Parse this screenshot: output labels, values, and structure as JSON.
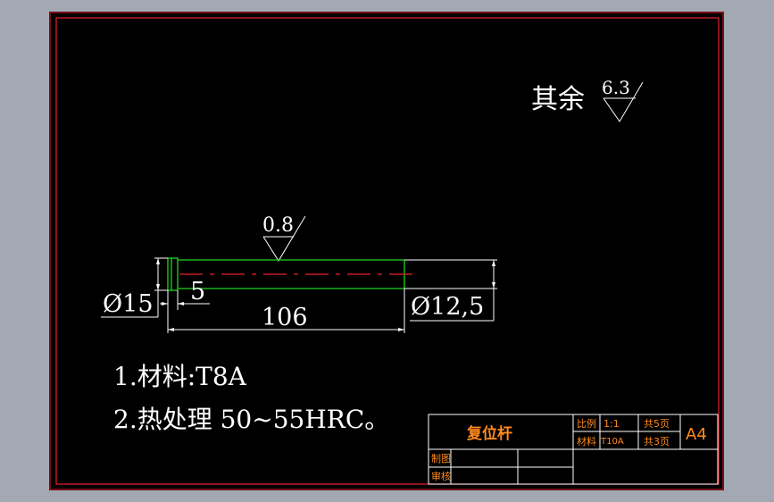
{
  "colors": {
    "background": "#a3a9b3",
    "sheet": "#000000",
    "frame": "#e8212b",
    "part_outline": "#1fd61f",
    "centerline": "#e8212b",
    "dimension": "#ffffff",
    "text": "#ffffff",
    "titleblock_text": "#ff8a1e"
  },
  "surface_finish": {
    "other_label": "其余",
    "other_value": "6.3",
    "shaft_value": "0.8"
  },
  "dimensions": {
    "head_diameter": "Ø15",
    "head_length": "5",
    "total_length": "106",
    "shaft_diameter": "Ø12,5"
  },
  "notes": {
    "line1": "1.材料:T8A",
    "line2": "2.热处理 50~55HRC。"
  },
  "title_block": {
    "part_name": "复位杆",
    "scale_label": "比例",
    "scale_value": "1:1",
    "material_label": "材料",
    "material_value": "T10A",
    "total_sheets": "共5页",
    "sheet_number": "共3页",
    "paper_size": "A4",
    "drawn_by_label": "制图",
    "checked_by_label": "审核"
  }
}
